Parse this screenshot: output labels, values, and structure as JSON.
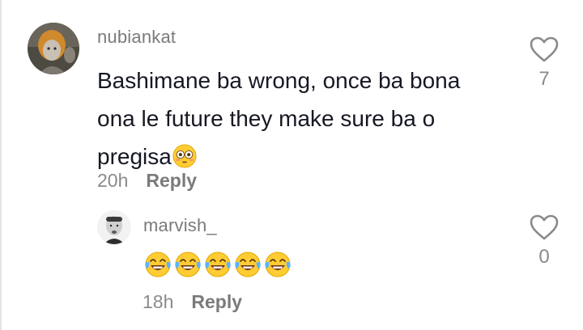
{
  "comment": {
    "username": "nubiankat",
    "text": "Bashimane ba wrong, once ba bona ona le future they make sure ba o pregisa",
    "text_emoji": "flushed-face",
    "timestamp": "20h",
    "reply_label": "Reply",
    "like_count": "7"
  },
  "reply": {
    "username": "marvish_",
    "emojis": [
      "face-with-tears-of-joy",
      "face-with-tears-of-joy",
      "face-with-tears-of-joy",
      "face-with-tears-of-joy",
      "face-with-tears-of-joy"
    ],
    "timestamp": "18h",
    "reply_label": "Reply",
    "like_count": "0"
  },
  "colors": {
    "primary_text": "#161823",
    "secondary_text": "#7a7a7a",
    "emoji_yellow": "#ffcc33"
  }
}
